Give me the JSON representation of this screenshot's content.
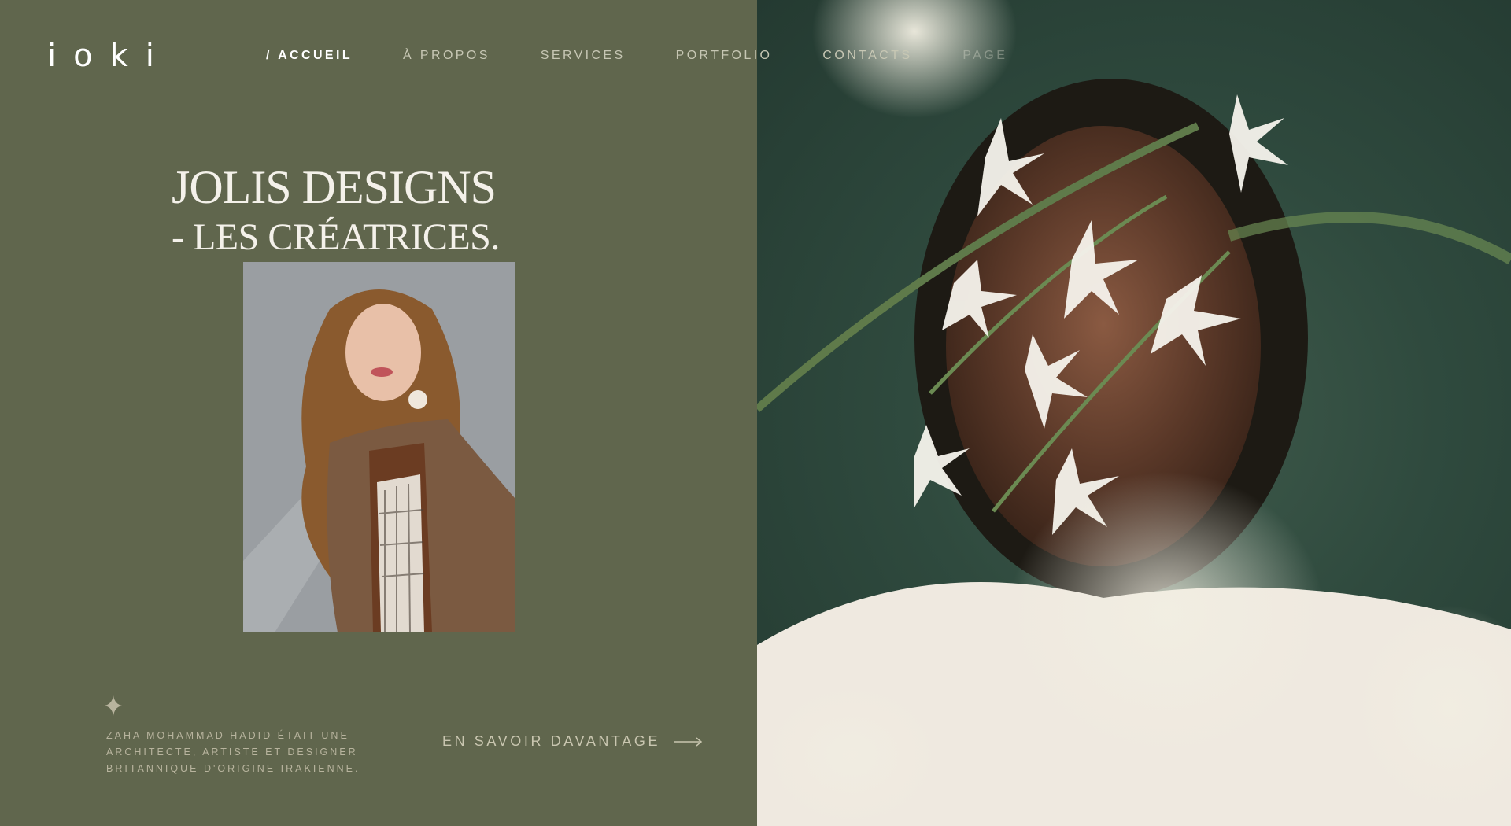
{
  "brand": {
    "logo_text": "ioki"
  },
  "nav": {
    "items": [
      {
        "label": "/ ACCUEIL",
        "active": true
      },
      {
        "label": "À PROPOS",
        "active": false
      },
      {
        "label": "SERVICES",
        "active": false
      },
      {
        "label": "PORTFOLIO",
        "active": false
      },
      {
        "label": "CONTACTS",
        "active": false
      },
      {
        "label": "PAGE",
        "active": false
      }
    ]
  },
  "hero": {
    "title": "JOLIS DESIGNS",
    "subtitle": "- LES CRÉATRICES."
  },
  "bio": {
    "text": "ZAHA MOHAMMAD HADID ÉTAIT UNE ARCHITECTE, ARTISTE ET DESIGNER BRITANNIQUE D'ORIGINE IRAKIENNE."
  },
  "cta": {
    "label": "EN SAVOIR DAVANTAGE"
  },
  "colors": {
    "background": "#60664d",
    "text_light": "#f4f1ea",
    "muted": "#b8b49e",
    "photo_bg": "#2f4a3e"
  },
  "icons": {
    "sparkle": "sparkle-icon",
    "arrow": "arrow-right-icon"
  }
}
